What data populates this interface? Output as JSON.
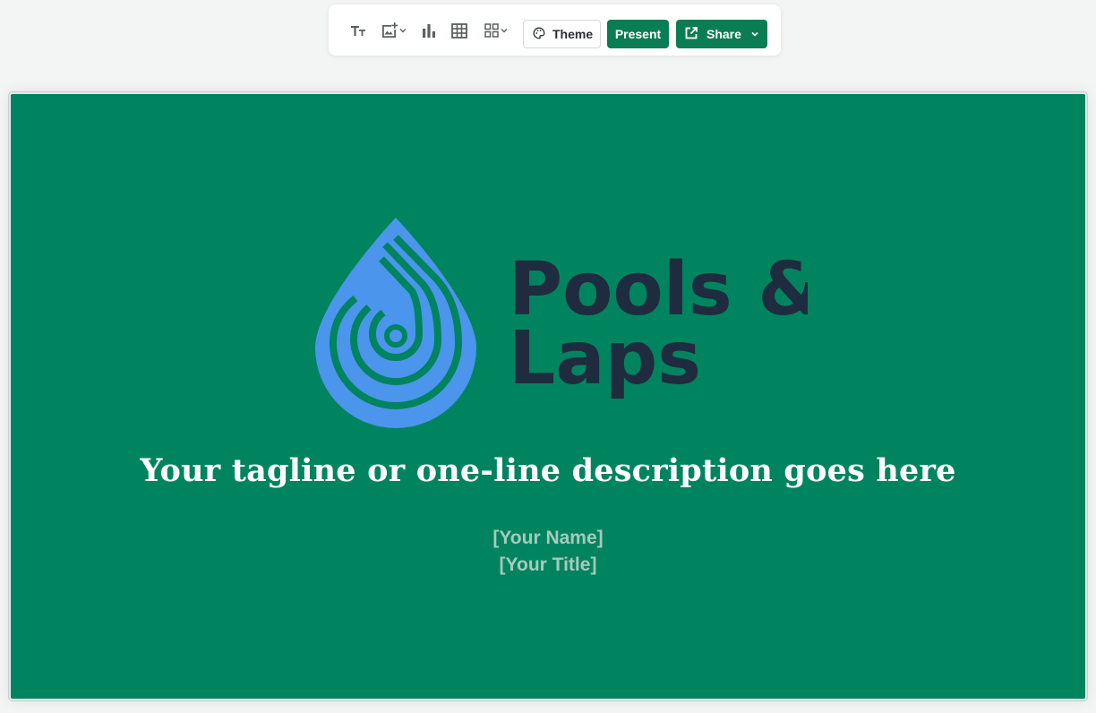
{
  "toolbar": {
    "tools": [
      {
        "icon": "text-size-icon"
      },
      {
        "icon": "add-image-icon",
        "has_dropdown": true
      },
      {
        "icon": "bar-chart-icon"
      },
      {
        "icon": "table-icon"
      },
      {
        "icon": "layout-grid-icon",
        "has_dropdown": true
      }
    ],
    "theme_label": "Theme",
    "present_label": "Present",
    "share_label": "Share",
    "accent_color": "#0b7d54"
  },
  "slide": {
    "background_color": "#00845f",
    "logo": {
      "brand_name_line1": "Pools &",
      "brand_name_line2": "Laps",
      "drop_color": "#4c95ec",
      "text_color": "#1f2b3e"
    },
    "tagline": "Your tagline or one-line description goes here",
    "name_placeholder": "[Your Name]",
    "title_placeholder": "[Your Title]"
  }
}
